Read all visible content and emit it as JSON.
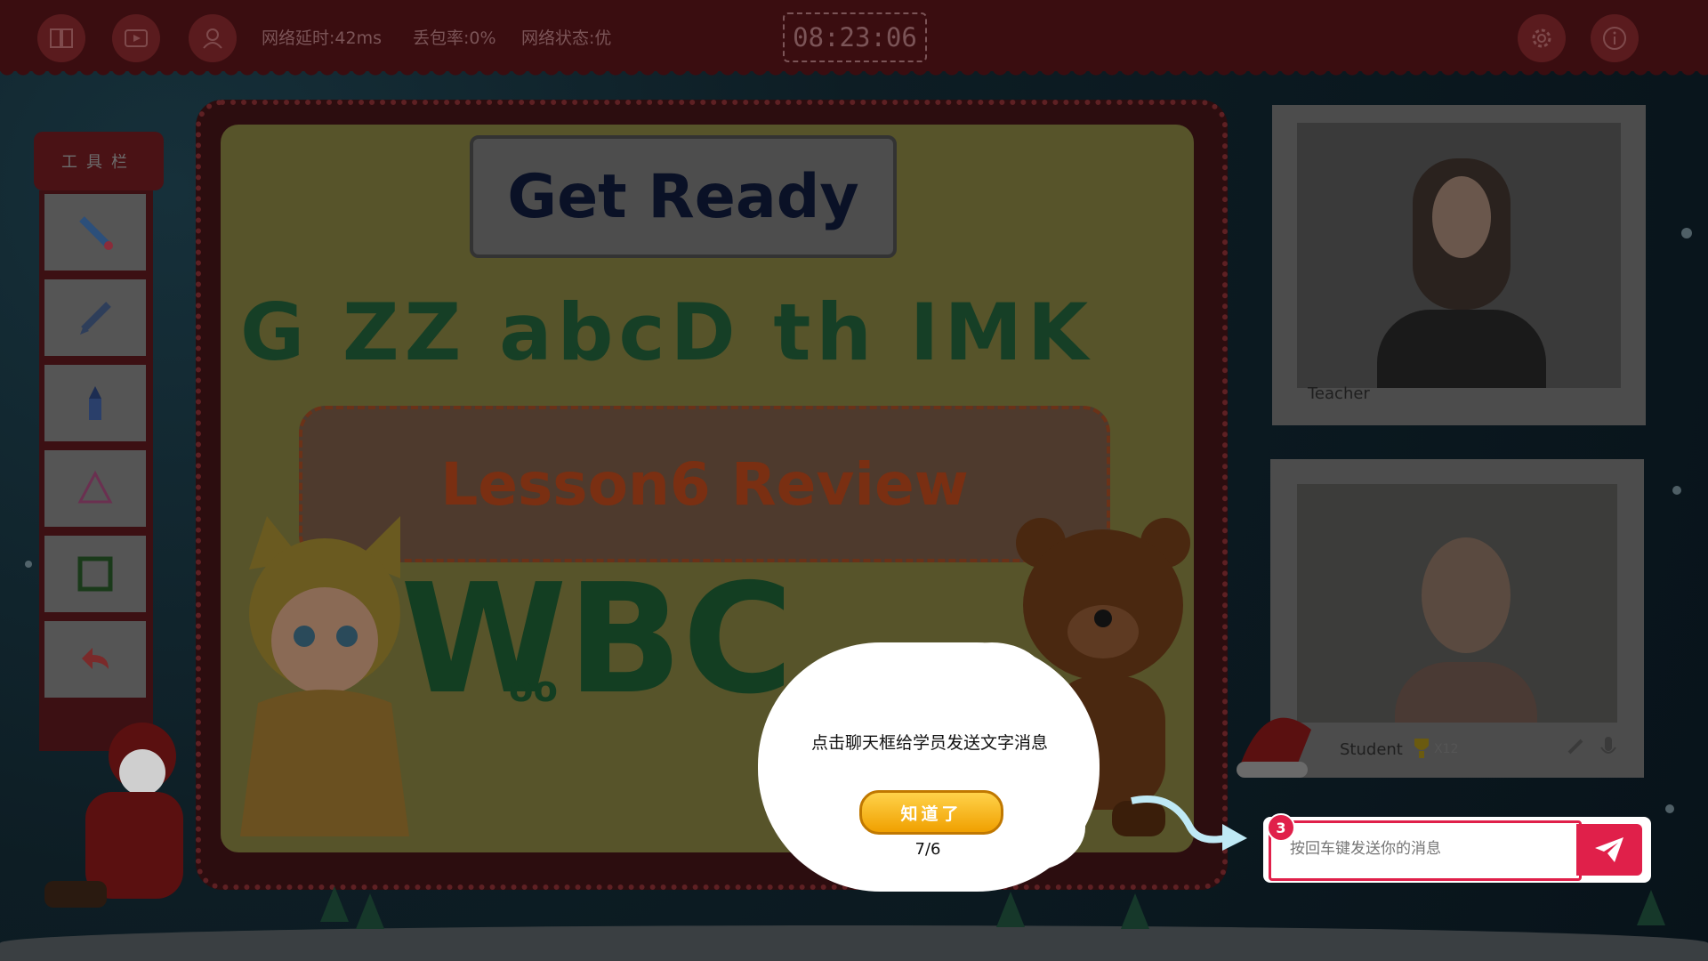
{
  "topbar": {
    "network_latency": "网络延时:42ms",
    "packet_loss": "丢包率:0%",
    "network_status": "网络状态:优",
    "timer": "08:23:06"
  },
  "toolbox": {
    "title": "工具栏",
    "tools": [
      "laser-pointer",
      "pencil",
      "crayon",
      "shapes",
      "rectangle",
      "undo"
    ]
  },
  "slide": {
    "heading": "Get Ready",
    "decor_letters": "G ZZ abcD th IMK",
    "lesson_title": "Lesson6 Review",
    "big_letters": "WBC",
    "oo": "oo"
  },
  "teacher": {
    "label": "Teacher"
  },
  "student": {
    "label": "Student",
    "trophy_count": "X12"
  },
  "guide": {
    "tip": "点击聊天框给学员发送文字消息",
    "button": "知道了",
    "step": "7/6"
  },
  "chat": {
    "badge": "3",
    "placeholder": "按回车键发送你的消息"
  }
}
